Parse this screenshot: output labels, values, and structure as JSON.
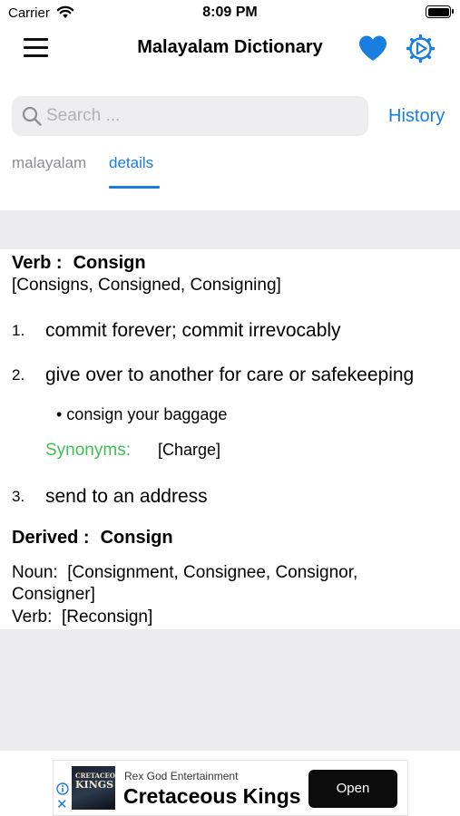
{
  "status_bar": {
    "carrier": "Carrier",
    "time": "8:09 PM"
  },
  "nav": {
    "title": "Malayalam Dictionary"
  },
  "search": {
    "placeholder": "Search ...",
    "value": ""
  },
  "history_label": "History",
  "tabs": [
    {
      "label": "malayalam",
      "selected": false
    },
    {
      "label": "details",
      "selected": true
    }
  ],
  "entry": {
    "pos": "Verb :",
    "word": "Consign",
    "forms": "[Consigns, Consigned, Consigning]",
    "definitions": [
      {
        "num": "1.",
        "text": "commit forever; commit irrevocably"
      },
      {
        "num": "2.",
        "text": "give over to another for care or safekeeping",
        "example": "• consign your baggage",
        "synonyms_label": "Synonyms:",
        "synonyms": "[Charge]"
      },
      {
        "num": "3.",
        "text": "send to an address"
      }
    ],
    "derived_label": "Derived :",
    "derived_word": "Consign",
    "derived": [
      {
        "pos": "Noun:",
        "words": "[Consignment, Consignee, Consignor, Consigner]"
      },
      {
        "pos": "Verb:",
        "words": "[Reconsign]"
      }
    ]
  },
  "ad": {
    "advertiser": "Rex God Entertainment",
    "title": "Cretaceous Kings",
    "thumb_line1": "CRETACEOUS",
    "thumb_line2": "KINGS",
    "button": "Open"
  },
  "colors": {
    "accent": "#1a7ee0",
    "synonym_green": "#3fbf52",
    "band_gray": "#ececef"
  },
  "icons": [
    "wifi-icon",
    "battery-icon",
    "menu-icon",
    "heart-icon",
    "gear-icon",
    "search-icon",
    "info-icon",
    "close-icon"
  ]
}
